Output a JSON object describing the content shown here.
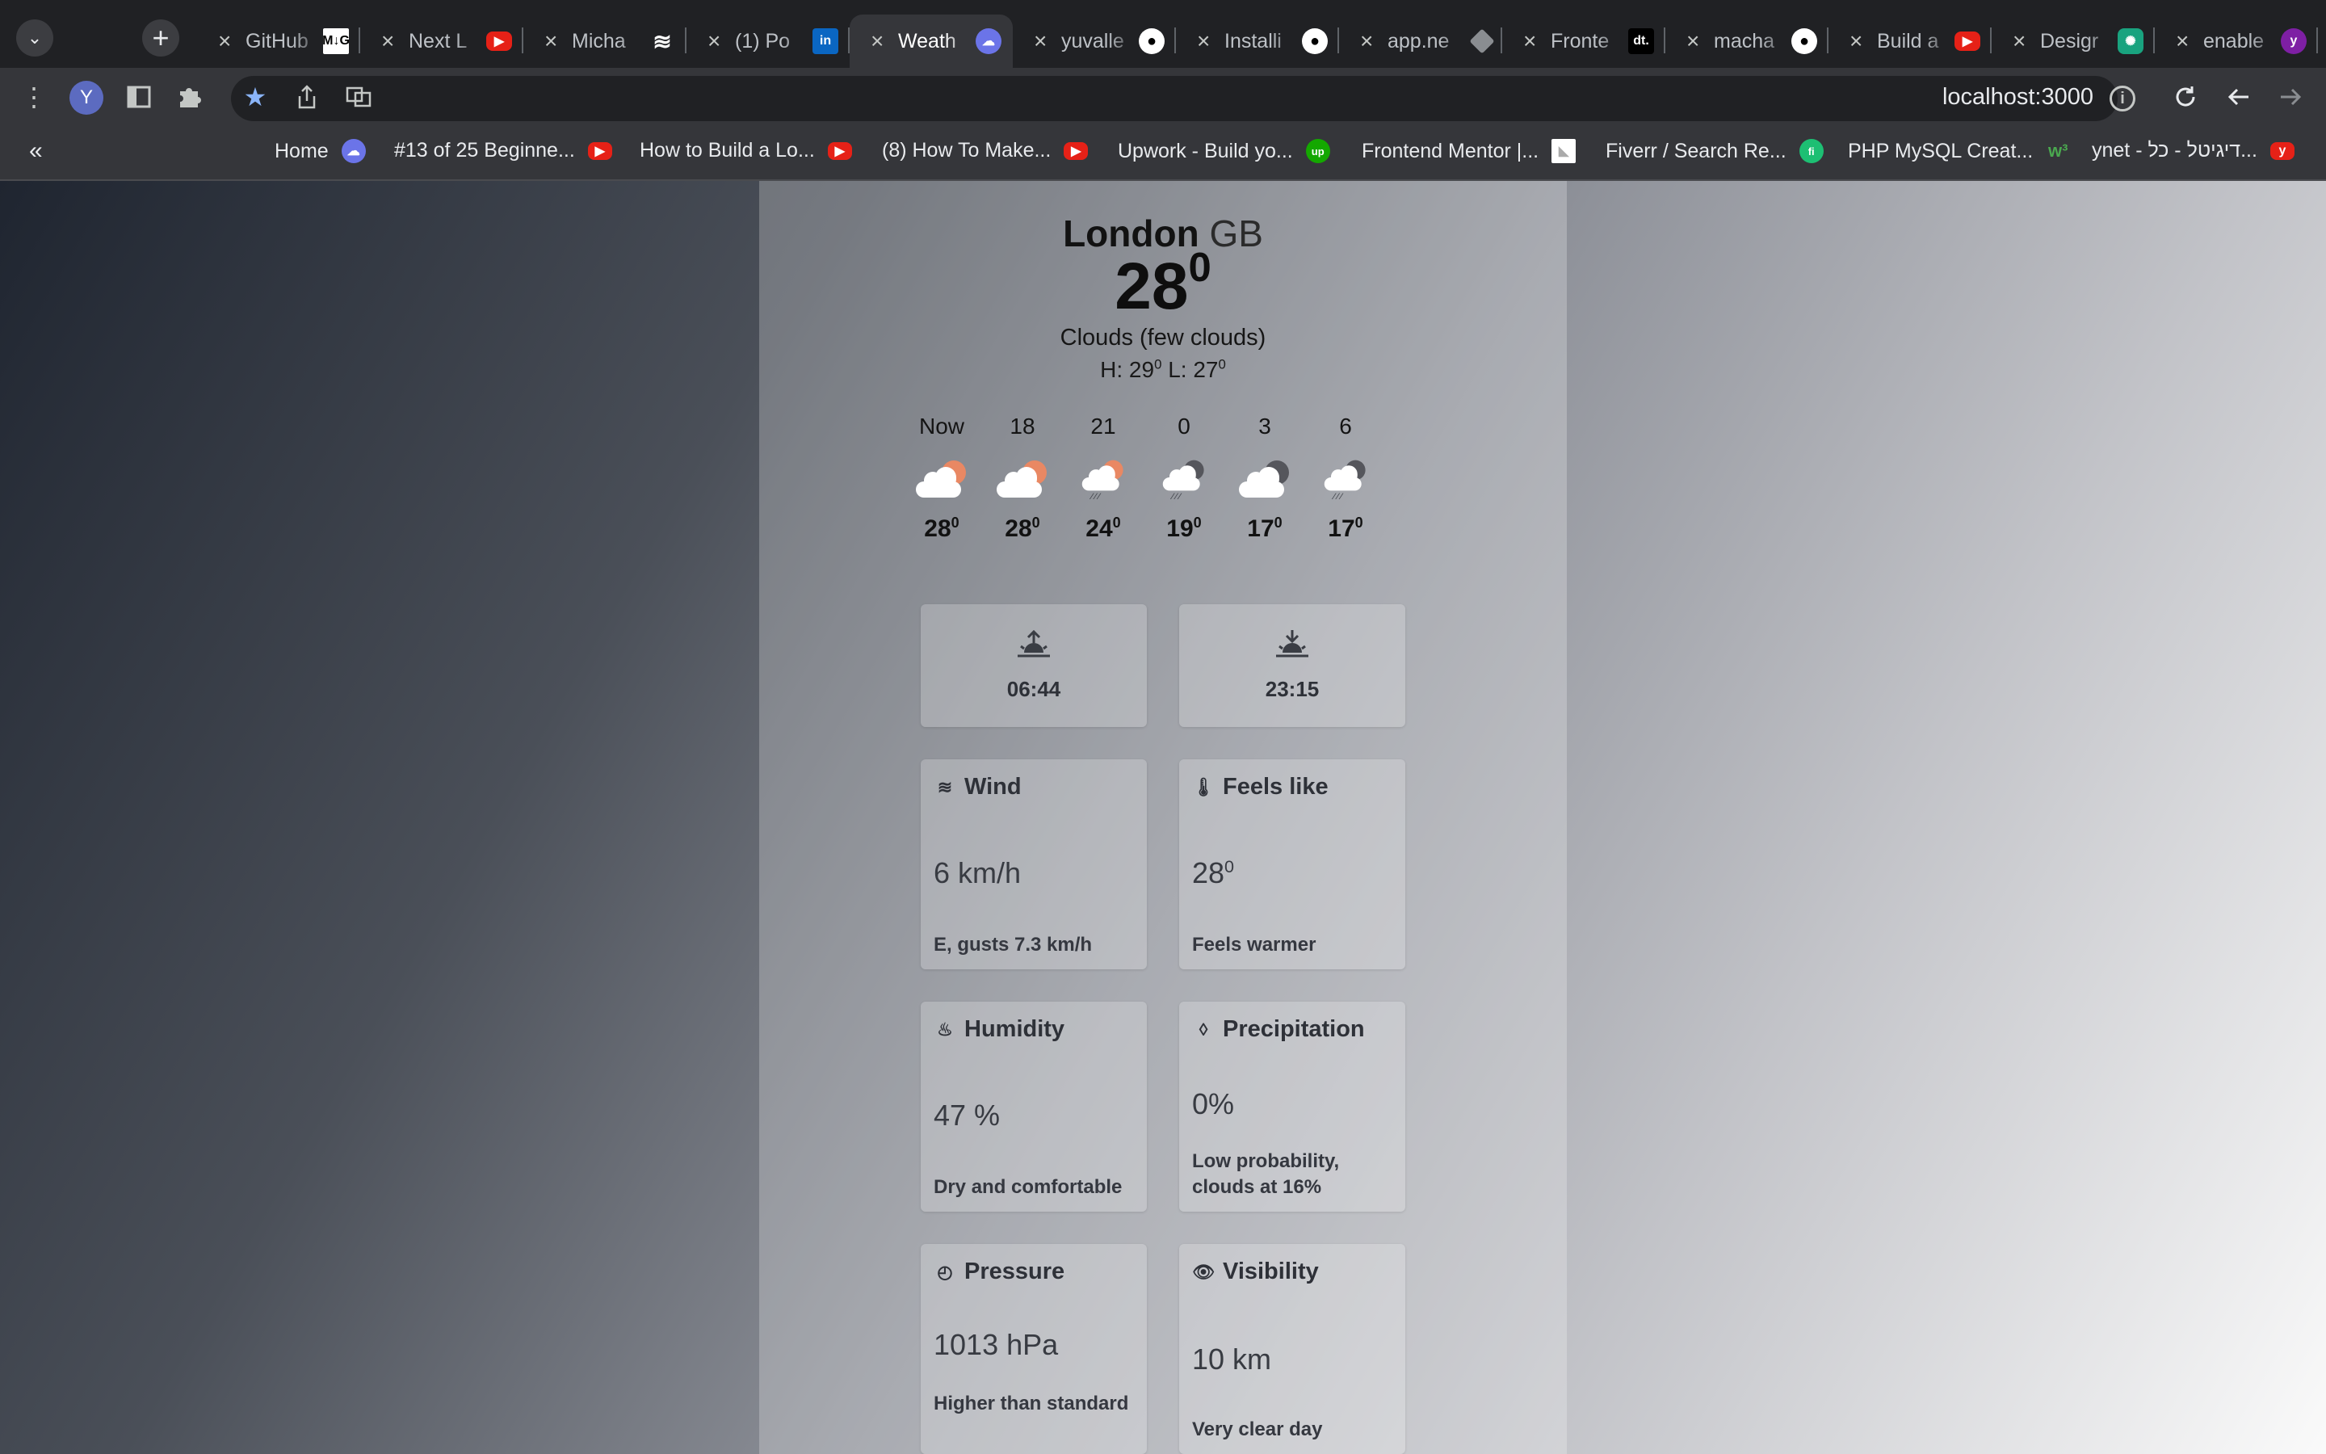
{
  "browser": {
    "tabs": [
      {
        "title": "GitHub",
        "icon": "notion-icon",
        "fav": "M↓G",
        "cls": "book",
        "active": false
      },
      {
        "title": "Next L",
        "icon": "youtube-icon",
        "fav": "▶",
        "cls": "yt",
        "active": false
      },
      {
        "title": "Micha",
        "icon": "stack-icon",
        "fav": "≋",
        "cls": "stack",
        "active": false
      },
      {
        "title": "(1) Po",
        "icon": "linkedin-icon",
        "fav": "in",
        "cls": "li",
        "active": false
      },
      {
        "title": "Weath",
        "icon": "weather-icon",
        "fav": "☁",
        "cls": "cloud",
        "active": true
      },
      {
        "title": "yuvalle",
        "icon": "github-icon",
        "fav": "●",
        "cls": "gh",
        "active": false
      },
      {
        "title": "Installi",
        "icon": "github-icon",
        "fav": "●",
        "cls": "gh",
        "active": false
      },
      {
        "title": "app.ne",
        "icon": "diamond-icon",
        "fav": "",
        "cls": "diamond",
        "active": false
      },
      {
        "title": "Fronte",
        "icon": "devto-icon",
        "fav": "dt.",
        "cls": "dt",
        "active": false
      },
      {
        "title": "macha",
        "icon": "github-icon",
        "fav": "●",
        "cls": "gh",
        "active": false
      },
      {
        "title": "Build a",
        "icon": "youtube-icon",
        "fav": "▶",
        "cls": "yt",
        "active": false
      },
      {
        "title": "Desigr",
        "icon": "chatgpt-icon",
        "fav": "✺",
        "cls": "gpt",
        "active": false
      },
      {
        "title": "enable",
        "icon": "yahoo-icon",
        "fav": "y",
        "cls": "yh",
        "active": false
      }
    ],
    "profile_initial": "Y",
    "url": "localhost:3000",
    "bookmarks_toggle": "«",
    "bookmarks": [
      {
        "label": "Home",
        "icon": "weather-icon",
        "fav": "☁",
        "cls": "cloud"
      },
      {
        "label": "#13 of 25 Beginne...",
        "icon": "youtube-icon",
        "fav": "▶",
        "cls": "yt"
      },
      {
        "label": "How to Build a Lo...",
        "icon": "youtube-icon",
        "fav": "▶",
        "cls": "yt"
      },
      {
        "label": "(8) How To Make...",
        "icon": "youtube-icon",
        "fav": "▶",
        "cls": "yt"
      },
      {
        "label": "Upwork - Build yo...",
        "icon": "upwork-icon",
        "fav": "up",
        "cls": "up"
      },
      {
        "label": "Frontend Mentor |...",
        "icon": "frontend-mentor-icon",
        "fav": "◣",
        "cls": "fm"
      },
      {
        "label": "Fiverr / Search Re...",
        "icon": "fiverr-icon",
        "fav": "fi",
        "cls": "fi"
      },
      {
        "label": "PHP MySQL Creat...",
        "icon": "w3schools-icon",
        "fav": "w³",
        "cls": "w"
      },
      {
        "label": "ynet - דיגיטל - כל...",
        "icon": "ynet-icon",
        "fav": "y",
        "cls": "yt"
      }
    ]
  },
  "weather": {
    "city": "London",
    "country": "GB",
    "temp": "28",
    "degree": "0",
    "condition": "Clouds (few clouds)",
    "high_label": "H: 29",
    "low_label": "L: 27",
    "hourly": [
      {
        "label": "Now",
        "temp": "28",
        "icon": "cloud-sun-icon",
        "kind": "sun"
      },
      {
        "label": "18",
        "temp": "28",
        "icon": "cloud-sun-icon",
        "kind": "sun"
      },
      {
        "label": "21",
        "temp": "24",
        "icon": "cloud-sun-rain-icon",
        "kind": "sun-rain"
      },
      {
        "label": "0",
        "temp": "19",
        "icon": "cloud-moon-rain-icon",
        "kind": "moon-rain"
      },
      {
        "label": "3",
        "temp": "17",
        "icon": "cloud-moon-icon",
        "kind": "moon"
      },
      {
        "label": "6",
        "temp": "17",
        "icon": "cloud-moon-rain-icon",
        "kind": "moon-rain"
      }
    ],
    "sunrise": "06:44",
    "sunset": "23:15",
    "cards": [
      {
        "key": "wind",
        "title": "Wind",
        "icon": "wind-icon",
        "glyph": "≋",
        "value": "6 km/h",
        "sup": "",
        "desc": "E, gusts 7.3 km/h"
      },
      {
        "key": "feels",
        "title": "Feels like",
        "icon": "thermometer-icon",
        "glyph": "🌡",
        "value": "28",
        "sup": "0",
        "desc": "Feels warmer"
      },
      {
        "key": "humidity",
        "title": "Humidity",
        "icon": "humidity-icon",
        "glyph": "♨",
        "value": "47 %",
        "sup": "",
        "desc": "Dry and comfortable"
      },
      {
        "key": "precipitation",
        "title": "Precipitation",
        "icon": "droplet-icon",
        "glyph": "◊",
        "value": "0%",
        "sup": "",
        "desc": "Low probability, clouds at 16%"
      },
      {
        "key": "pressure",
        "title": "Pressure",
        "icon": "gauge-icon",
        "glyph": "◴",
        "value": "1013 hPa",
        "sup": "",
        "desc": "Higher than standard"
      },
      {
        "key": "visibility",
        "title": "Visibility",
        "icon": "eye-icon",
        "glyph": "👁",
        "value": "10 km",
        "sup": "",
        "desc": "Very clear day"
      }
    ]
  }
}
